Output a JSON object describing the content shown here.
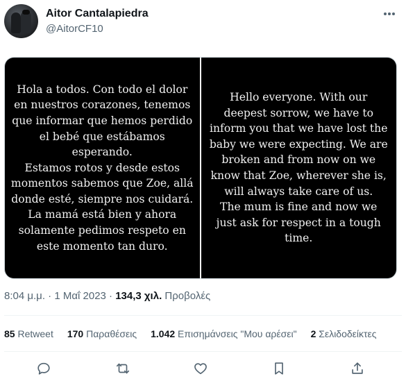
{
  "author": {
    "display_name": "Aitor Cantalapiedra",
    "handle": "@AitorCF10"
  },
  "media": {
    "left_text": "Hola a todos. Con todo el dolor\nen nuestros corazones, tenemos\nque informar que hemos perdido\nel bebé que estábamos esperando.\nEstamos rotos y desde estos\nmomentos sabemos que Zoe, allá\ndonde esté, siempre nos cuidará.\nLa mamá está bien y ahora\nsolamente pedimos respeto en\neste momento tan duro.",
    "right_text": "Hello everyone. With our\ndeepest sorrow, we have to\ninform you that we have lost the\nbaby we were expecting. We are\nbroken and from now on we\nknow that Zoe, wherever she is,\nwill always take care of us.\nThe mum is fine and now we\njust ask for respect in a tough\ntime."
  },
  "meta": {
    "time": "8:04 μ.μ.",
    "separator": "·",
    "date": "1 Μαΐ 2023",
    "views_count": "134,3 χιλ.",
    "views_label": "Προβολές"
  },
  "stats": [
    {
      "count": "85",
      "label": "Retweet"
    },
    {
      "count": "170",
      "label": "Παραθέσεις"
    },
    {
      "count": "1.042",
      "label": "Επισημάνσεις \"Μου αρέσει\""
    },
    {
      "count": "2",
      "label": "Σελιδοδείκτες"
    }
  ],
  "icons": {
    "more": "more-dots-icon",
    "reply": "reply-icon",
    "retweet": "retweet-icon",
    "like": "heart-icon",
    "bookmark": "bookmark-icon",
    "share": "share-icon"
  }
}
